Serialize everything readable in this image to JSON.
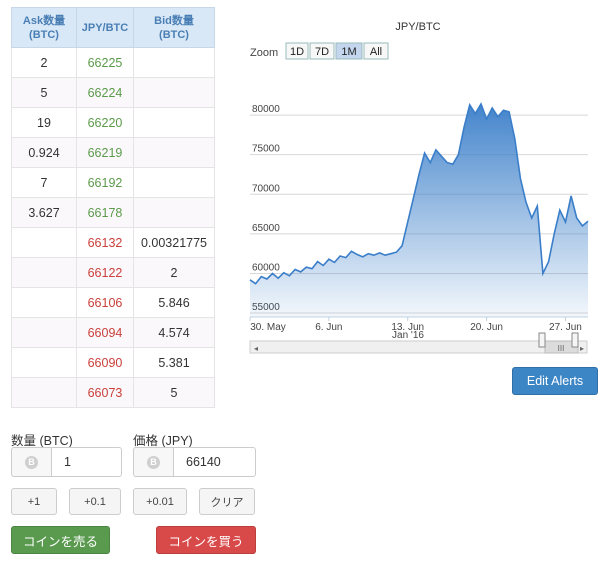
{
  "book": {
    "headers": [
      "Ask数量\n(BTC)",
      "JPY/BTC",
      "Bid数量\n(BTC)"
    ],
    "rows": [
      {
        "ask": "2",
        "price": "66225",
        "bid": "",
        "side": "ask"
      },
      {
        "ask": "5",
        "price": "66224",
        "bid": "",
        "side": "ask"
      },
      {
        "ask": "19",
        "price": "66220",
        "bid": "",
        "side": "ask"
      },
      {
        "ask": "0.924",
        "price": "66219",
        "bid": "",
        "side": "ask"
      },
      {
        "ask": "7",
        "price": "66192",
        "bid": "",
        "side": "ask"
      },
      {
        "ask": "3.627",
        "price": "66178",
        "bid": "",
        "side": "ask"
      },
      {
        "ask": "",
        "price": "66132",
        "bid": "0.00321775",
        "side": "bid"
      },
      {
        "ask": "",
        "price": "66122",
        "bid": "2",
        "side": "bid"
      },
      {
        "ask": "",
        "price": "66106",
        "bid": "5.846",
        "side": "bid"
      },
      {
        "ask": "",
        "price": "66094",
        "bid": "4.574",
        "side": "bid"
      },
      {
        "ask": "",
        "price": "66090",
        "bid": "5.381",
        "side": "bid"
      },
      {
        "ask": "",
        "price": "66073",
        "bid": "5",
        "side": "bid"
      }
    ]
  },
  "chart_data": {
    "type": "area",
    "title": "JPY/BTC",
    "zoom_label": "Zoom",
    "zoom_options": [
      "1D",
      "7D",
      "1M",
      "All"
    ],
    "zoom_active": "1M",
    "y_ticks": [
      55000,
      60000,
      65000,
      70000,
      75000,
      80000
    ],
    "x_ticks": [
      "30. May",
      "6. Jun",
      "13. Jun",
      "20. Jun",
      "27. Jun"
    ],
    "x_tick_days": [
      0,
      7,
      14,
      21,
      28
    ],
    "navigator_label": "Jan '16",
    "ylim": [
      54500,
      83800
    ],
    "xlim": [
      0,
      30
    ],
    "grid": true,
    "series": [
      {
        "points": [
          [
            0,
            59200
          ],
          [
            0.5,
            58700
          ],
          [
            1,
            59600
          ],
          [
            1.5,
            59300
          ],
          [
            2,
            60000
          ],
          [
            2.5,
            59400
          ],
          [
            3,
            60100
          ],
          [
            3.5,
            59700
          ],
          [
            4,
            60500
          ],
          [
            4.5,
            60200
          ],
          [
            5,
            60800
          ],
          [
            5.5,
            60600
          ],
          [
            6,
            61500
          ],
          [
            6.5,
            61000
          ],
          [
            7,
            61800
          ],
          [
            7.5,
            61400
          ],
          [
            8,
            62200
          ],
          [
            8.5,
            62000
          ],
          [
            9,
            62800
          ],
          [
            9.5,
            62400
          ],
          [
            10,
            62100
          ],
          [
            10.5,
            62500
          ],
          [
            11,
            62300
          ],
          [
            11.5,
            62600
          ],
          [
            12,
            62300
          ],
          [
            12.5,
            62500
          ],
          [
            13,
            62700
          ],
          [
            13.5,
            63500
          ],
          [
            14,
            66500
          ],
          [
            14.5,
            69500
          ],
          [
            15,
            72500
          ],
          [
            15.5,
            75200
          ],
          [
            16,
            74000
          ],
          [
            16.5,
            75600
          ],
          [
            17,
            74800
          ],
          [
            17.5,
            74000
          ],
          [
            18,
            73800
          ],
          [
            18.5,
            75000
          ],
          [
            19,
            78500
          ],
          [
            19.5,
            81300
          ],
          [
            20,
            80200
          ],
          [
            20.5,
            81400
          ],
          [
            21,
            79500
          ],
          [
            21.5,
            80900
          ],
          [
            22,
            79800
          ],
          [
            22.5,
            80600
          ],
          [
            23,
            80400
          ],
          [
            23.5,
            77000
          ],
          [
            24,
            72000
          ],
          [
            24.5,
            69000
          ],
          [
            25,
            67000
          ],
          [
            25.5,
            68500
          ],
          [
            26,
            60000
          ],
          [
            26.5,
            61500
          ],
          [
            27,
            65000
          ],
          [
            27.5,
            68000
          ],
          [
            28,
            66500
          ],
          [
            28.5,
            69800
          ],
          [
            29,
            67000
          ],
          [
            29.5,
            66000
          ],
          [
            30,
            66600
          ]
        ]
      }
    ]
  },
  "edit_alerts_label": "Edit Alerts",
  "form": {
    "qty_label": "数量 (BTC)",
    "qty_value": "1",
    "price_label": "価格 (JPY)",
    "price_value": "66140",
    "coin_icon_glyph": "B",
    "step_buttons": [
      "+1",
      "+0.1",
      "+0.01",
      "クリア"
    ],
    "sell_label": "コインを売る",
    "buy_label": "コインを買う"
  },
  "colors": {
    "accent_blue": "#3d86c6",
    "sell_green": "#5a9a4f",
    "buy_red": "#d84949",
    "ask_price_green": "#5b9a4a",
    "bid_price_red": "#c9403b",
    "line_blue": "#3a7ec9"
  }
}
